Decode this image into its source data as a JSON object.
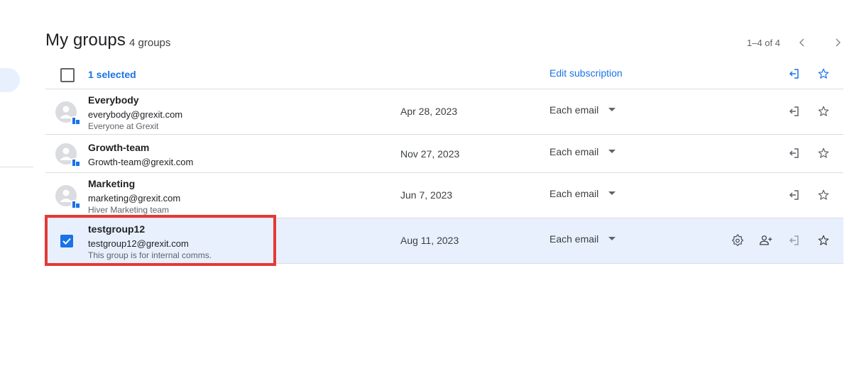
{
  "header": {
    "title": "My groups",
    "count": "4 groups",
    "pagination": "1–4 of 4"
  },
  "toolbar": {
    "selected_label": "1 selected",
    "edit_subscription_label": "Edit subscription"
  },
  "groups": [
    {
      "name": "Everybody",
      "email": "everybody@grexit.com",
      "description": "Everyone at Grexit",
      "date": "Apr 28, 2023",
      "subscription": "Each email",
      "selected": false
    },
    {
      "name": "Growth-team",
      "email": "Growth-team@grexit.com",
      "description": "",
      "date": "Nov 27, 2023",
      "subscription": "Each email",
      "selected": false
    },
    {
      "name": "Marketing",
      "email": "marketing@grexit.com",
      "description": "Hiver Marketing team",
      "date": "Jun 7, 2023",
      "subscription": "Each email",
      "selected": false
    },
    {
      "name": "testgroup12",
      "email": "testgroup12@grexit.com",
      "description": "This group is for internal comms.",
      "date": "Aug 11, 2023",
      "subscription": "Each email",
      "selected": true
    }
  ],
  "icons": {
    "leave": "leave-group-icon",
    "star": "star-icon",
    "settings": "settings-gear-icon",
    "add_member": "add-member-icon",
    "dropdown": "dropdown-arrow-icon",
    "avatar": "group-avatar-icon",
    "checkbox": "checkbox-icon"
  },
  "colors": {
    "accent": "#1a73e8",
    "selected_row": "#e8f0fe",
    "highlight": "#e53935"
  }
}
